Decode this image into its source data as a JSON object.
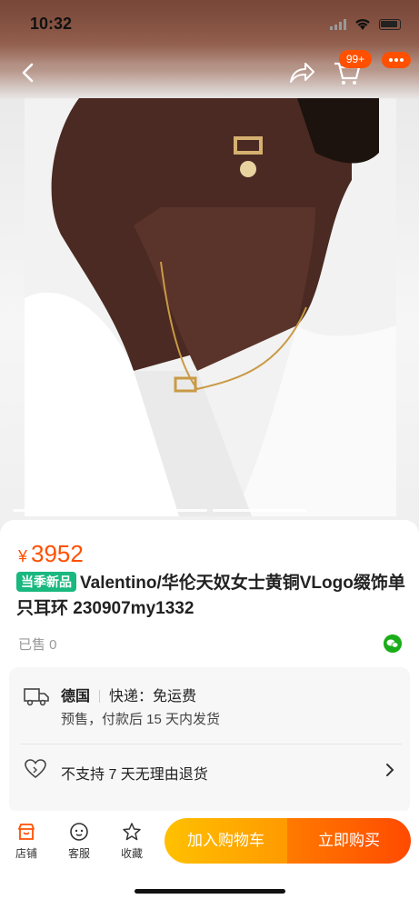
{
  "status_bar": {
    "time": "10:32"
  },
  "nav": {
    "cart_badge": "99+"
  },
  "product": {
    "price_symbol": "¥",
    "price": "3952",
    "tag": "当季新品",
    "title": "Valentino/华伦天奴女士黄铜VLogo缀饰单只耳环 230907my1332",
    "sold": "已售 0"
  },
  "shipping": {
    "origin": "德国",
    "delivery": "快递：免运费",
    "presale": "预售，付款后 15 天内发货"
  },
  "returns": {
    "text": "不支持 7 天无理由退货"
  },
  "bottom_bar": {
    "store": "店铺",
    "service": "客服",
    "favorite": "收藏",
    "add_to_cart": "加入购物车",
    "buy_now": "立即购买"
  },
  "colors": {
    "accent": "#ff5000",
    "tag_green": "#19b87f",
    "cart_btn": "#ffb000",
    "buy_btn": "#ff5a00"
  },
  "icons": [
    "back-icon",
    "share-icon",
    "cart-icon",
    "more-icon",
    "truck-icon",
    "heart-icon",
    "chevron-right-icon",
    "store-icon",
    "service-icon",
    "star-icon",
    "wechat-icon"
  ]
}
